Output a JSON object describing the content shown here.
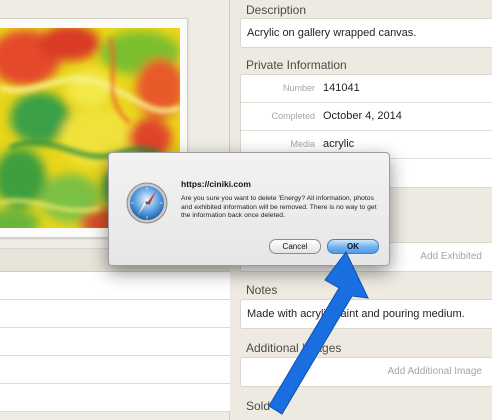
{
  "details": {
    "description": {
      "header": "Description",
      "value": "Acrylic on gallery wrapped canvas."
    },
    "private_information": {
      "header": "Private Information",
      "rows": [
        {
          "label": "Number",
          "value": "141041"
        },
        {
          "label": "Completed",
          "value": "October 4, 2014"
        },
        {
          "label": "Media",
          "value": "acrylic"
        },
        {
          "label": "",
          "value": ""
        }
      ]
    },
    "exhibited": {
      "button_label": "Add Exhibited"
    },
    "notes": {
      "header": "Notes",
      "value": "Made with acrylic paint and pouring medium."
    },
    "additional_images": {
      "header": "Additional Images",
      "button_label": "Add Additional Image"
    },
    "sold_to": {
      "header": "Sold to"
    }
  },
  "dialog": {
    "title": "https://ciniki.com",
    "message": "Are you sure you want to delete 'Energy?  All information, photos and exhibited information will be removed. There is no way to get the information back once deleted.",
    "cancel_label": "Cancel",
    "ok_label": "OK",
    "icon": "safari-compass-icon"
  },
  "colors": {
    "arrow": "#1a6fe0",
    "ok_button": "#5aa5ea",
    "background": "#eeeae2"
  }
}
